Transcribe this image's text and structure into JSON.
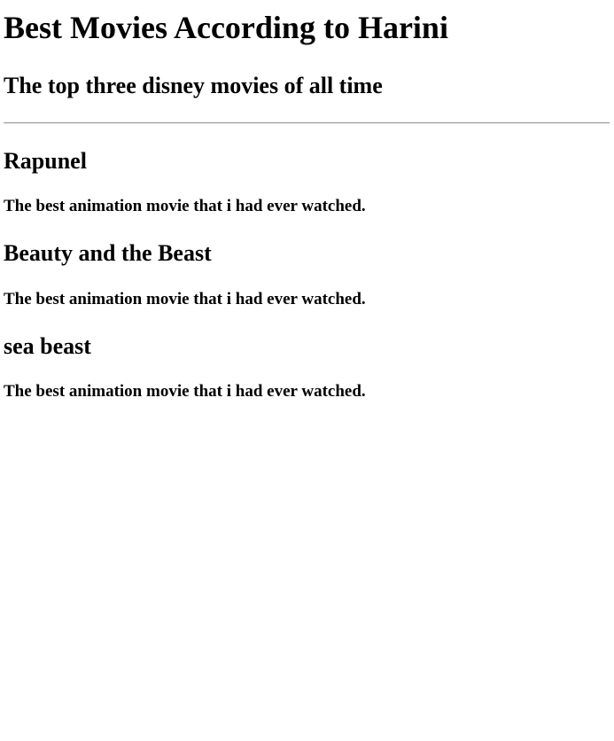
{
  "page": {
    "title": "Best Movies According to Harini",
    "subtitle": "The top three disney movies of all time"
  },
  "movies": [
    {
      "title": "Rapunel",
      "description": "The best animation movie that i had ever watched."
    },
    {
      "title": "Beauty and the Beast",
      "description": "The best animation movie that i had ever watched."
    },
    {
      "title": "sea beast",
      "description": "The best animation movie that i had ever watched."
    }
  ]
}
